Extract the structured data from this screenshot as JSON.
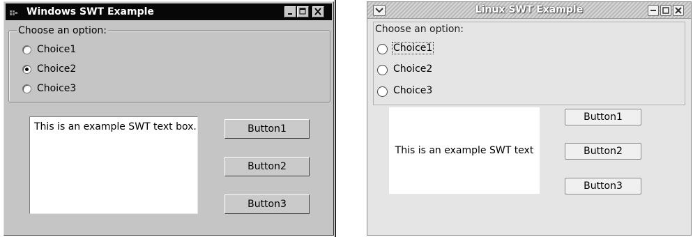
{
  "windows": {
    "title": "Windows SWT Example",
    "group_label": "Choose an option:",
    "choices": [
      {
        "label": "Choice1",
        "selected": false
      },
      {
        "label": "Choice2",
        "selected": true
      },
      {
        "label": "Choice3",
        "selected": false
      }
    ],
    "textbox": "This is an example SWT text box.",
    "buttons": [
      "Button1",
      "Button2",
      "Button3"
    ]
  },
  "linux": {
    "title": "Linux SWT Example",
    "group_label": "Choose an option:",
    "choices": [
      {
        "label": "Choice1",
        "selected": false,
        "focused": true
      },
      {
        "label": "Choice2",
        "selected": false
      },
      {
        "label": "Choice3",
        "selected": false
      }
    ],
    "textbox": "This is an example SWT text",
    "buttons": [
      "Button1",
      "Button2",
      "Button3"
    ]
  },
  "colors": {
    "windows_face": "#c5c5c5",
    "windows_titlebar": "#070707",
    "linux_face": "#e5e5e5"
  }
}
